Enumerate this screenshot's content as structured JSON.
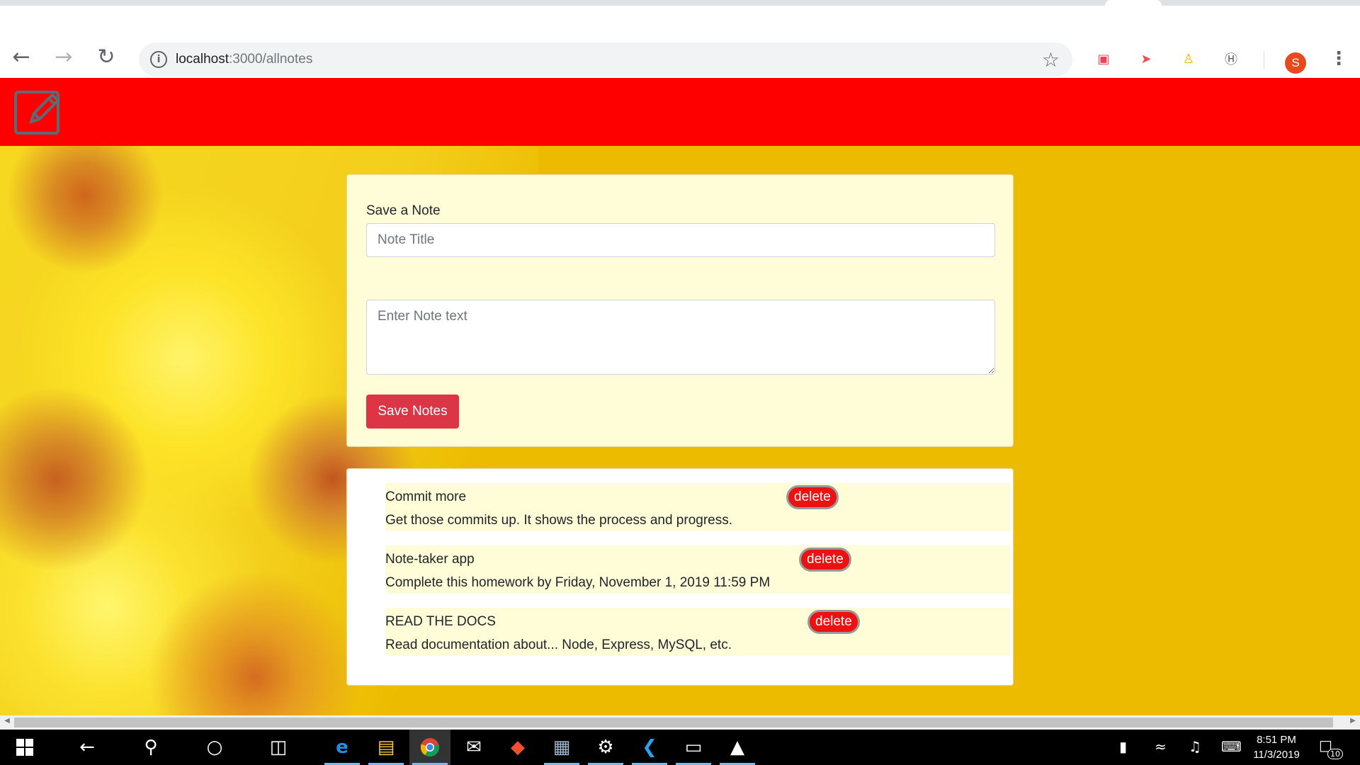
{
  "browser": {
    "url_host": "localhost",
    "url_path": ":3000/allnotes",
    "avatar_letter": "S",
    "icons": [
      "back-icon",
      "forward-icon",
      "reload-icon",
      "info-icon",
      "star-icon",
      "pocket-extension-icon",
      "extension-red-arrow-icon",
      "extension-trophy-icon",
      "extension-h-icon",
      "menu-dots-icon"
    ]
  },
  "app": {
    "navbar_color": "#ff0000",
    "logo_icon": "edit-pencil-icon"
  },
  "form": {
    "label": "Save a Note",
    "title_placeholder": "Note Title",
    "text_placeholder": "Enter Note text",
    "save_label": "Save Notes"
  },
  "notes": [
    {
      "title": "Commit more",
      "text": "Get those commits up. It shows the process and progress.",
      "delete_label": "delete"
    },
    {
      "title": "Note-taker app",
      "text": "Complete this homework by Friday, November 1, 2019 11:59 PM",
      "delete_label": "delete"
    },
    {
      "title": "READ THE DOCS",
      "text": "Read documentation about... Node, Express, MySQL, etc.",
      "delete_label": "delete"
    }
  ],
  "taskbar": {
    "clock_time": "8:51 PM",
    "clock_date": "11/3/2019",
    "notification_count": "10",
    "apps": [
      "start-icon",
      "back-icon",
      "search-icon",
      "cortana-icon",
      "task-view-icon",
      "edge-icon",
      "file-explorer-icon",
      "chrome-icon",
      "mail-icon",
      "git-icon",
      "ssms-icon",
      "settings-icon",
      "vscode-icon",
      "terminal-icon",
      "photos-icon"
    ]
  }
}
